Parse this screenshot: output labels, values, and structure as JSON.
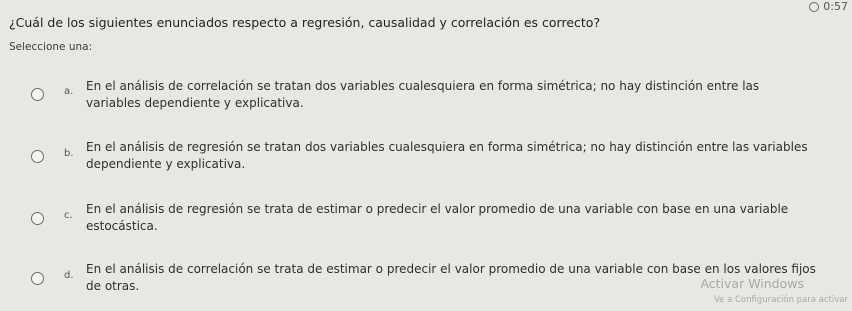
{
  "timer": {
    "time": "0:57"
  },
  "question": {
    "text": "¿Cuál de los siguientes enunciados respecto a regresión, causalidad y correlación es correcto?",
    "instruction": "Seleccione una:"
  },
  "options": [
    {
      "letter": "a.",
      "line1": "En el análisis de correlación se tratan dos variables cualesquiera en forma simétrica; no hay distinción entre las",
      "line2": "variables dependiente y explicativa."
    },
    {
      "letter": "b.",
      "line1": "En el análisis de regresión se tratan dos variables cualesquiera en forma simétrica; no hay distinción entre las variables",
      "line2": "dependiente y explicativa."
    },
    {
      "letter": "c.",
      "line1": "En el análisis de regresión se trata de estimar o predecir el valor promedio de una variable con base en una variable",
      "line2": "estocástica."
    },
    {
      "letter": "d.",
      "line1": "En el análisis de correlación se trata de estimar o predecir el valor promedio de una variable con base en los valores fijos",
      "line2": "de otras."
    }
  ],
  "watermark": {
    "title": "Activar Windows",
    "subtitle": "Ve a Configuración para activar"
  }
}
